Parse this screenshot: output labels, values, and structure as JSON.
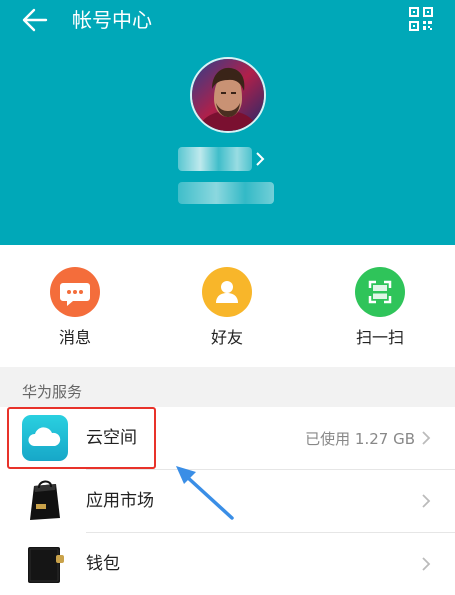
{
  "header": {
    "title": "帐号中心",
    "bg_color": "#00a8b8",
    "back_icon": "back-arrow-icon",
    "qr_icon": "qr-code-icon"
  },
  "quick_actions": [
    {
      "label": "消息",
      "icon": "message-icon",
      "color": "#f46d3b"
    },
    {
      "label": "好友",
      "icon": "friends-icon",
      "color": "#f8b62a"
    },
    {
      "label": "扫一扫",
      "icon": "scan-icon",
      "color": "#2fc45a"
    }
  ],
  "section": {
    "title": "华为服务"
  },
  "services": [
    {
      "label": "云空间",
      "value": "已使用 1.27 GB",
      "icon": "cloud-icon"
    },
    {
      "label": "应用市场",
      "value": "",
      "icon": "app-market-icon"
    },
    {
      "label": "钱包",
      "value": "",
      "icon": "wallet-icon"
    }
  ],
  "annotation": {
    "highlight_color": "#e8322a",
    "arrow_color": "#3a8ee6"
  }
}
